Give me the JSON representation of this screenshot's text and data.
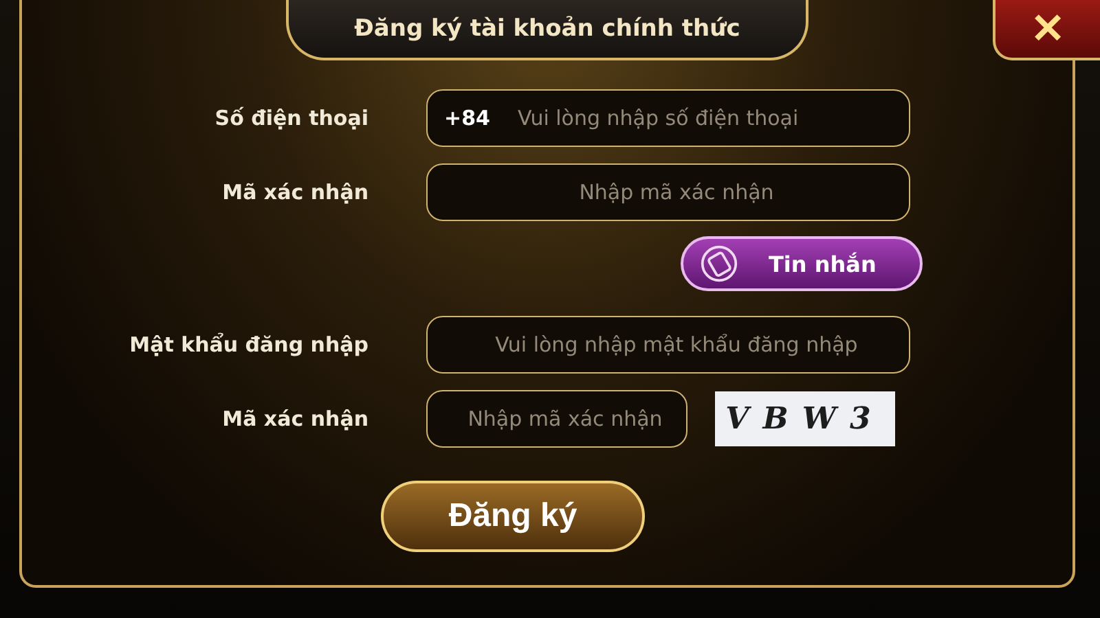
{
  "dialog": {
    "title": "Đăng ký tài khoản chính thức",
    "close": "✕"
  },
  "form": [
    {
      "kind": "phone",
      "label": "Số điện thoại",
      "prefix": "+84",
      "placeholder": "Vui lòng nhập số điện thoại"
    },
    {
      "kind": "field",
      "label": "Mã xác nhận",
      "placeholder": "Nhập mã xác nhận"
    },
    {
      "kind": "sms",
      "button": "Tin nhắn"
    },
    {
      "kind": "field",
      "label": "Mật khẩu đăng nhập",
      "placeholder": "Vui lòng nhập mật khẩu đăng nhập"
    },
    {
      "kind": "captcha",
      "label": "Mã xác nhận",
      "placeholder": "Nhập mã xác nhận",
      "captcha": "VBW3"
    }
  ],
  "submit": "Đăng ký"
}
